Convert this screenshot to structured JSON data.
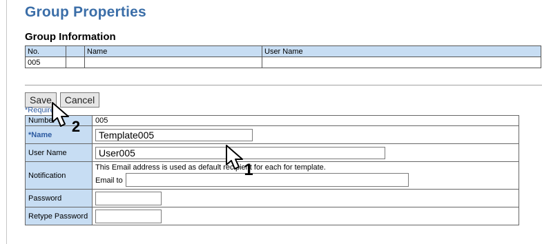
{
  "page": {
    "title": "Group Properties",
    "section_title": "Group Information"
  },
  "group_table": {
    "headers": [
      "No.",
      "",
      "Name",
      "User Name"
    ],
    "row": [
      "005",
      "",
      "",
      ""
    ]
  },
  "buttons": {
    "save": "Save",
    "cancel": "Cancel"
  },
  "required_note": "*Required",
  "form": {
    "number_label": "Number",
    "number_value": "005",
    "name_label": "*Name",
    "name_value": "Template005",
    "user_name_label": "User Name",
    "user_name_value": "User005",
    "notification_label": "Notification",
    "notification_note": "This Email address is used as default recipient for each for template.",
    "email_label": "Email to",
    "email_value": "",
    "password_label": "Password",
    "password_value": "",
    "retype_password_label": "Retype Password",
    "retype_password_value": ""
  },
  "callouts": {
    "step1": "1",
    "step2": "2"
  }
}
